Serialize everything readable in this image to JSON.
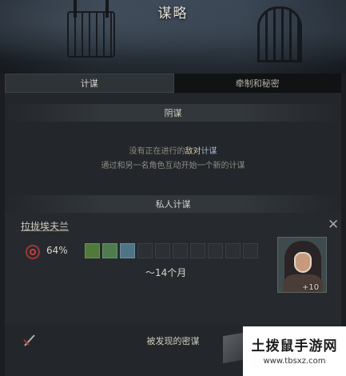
{
  "header": {
    "title": "谋略"
  },
  "tabs": [
    {
      "label": "计谋",
      "active": true
    },
    {
      "label": "牵制和秘密",
      "active": false
    }
  ],
  "hostile": {
    "heading": "阴谋",
    "line1_pre": "没有正在进行的",
    "line1_hl1": "敌对",
    "line1_hl2": "计谋",
    "line2": "通过和另一名角色互动开始一个新的计谋"
  },
  "personal": {
    "heading": "私人计谋",
    "scheme_name": "拉拢埃夫兰",
    "success_chance": "64%",
    "progress_slots": [
      "green",
      "green",
      "blue",
      "empty",
      "empty",
      "empty",
      "empty",
      "empty",
      "empty",
      "empty"
    ],
    "duration": "～14个月",
    "opinion": "+10"
  },
  "secret": {
    "label": "被发现的密谋"
  },
  "watermark": {
    "title": "土拨鼠手游网",
    "url": "www.tbsxz.com"
  },
  "colors": {
    "danger": "#a43535",
    "progress_green": "#4f7a3a",
    "progress_blue": "#4f7486"
  }
}
